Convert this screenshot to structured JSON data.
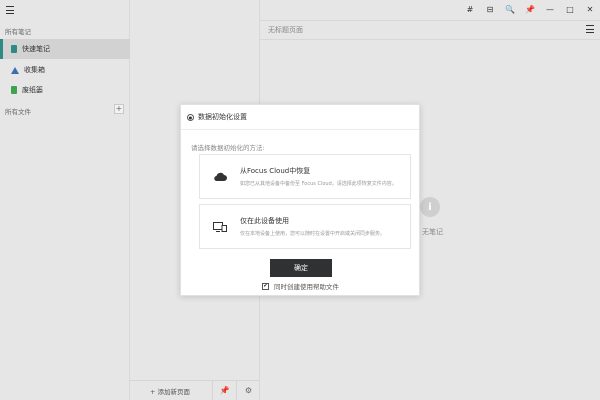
{
  "titlebar": {
    "buttons": [
      "#",
      "⊟",
      "🔍",
      "📌",
      "—",
      "□",
      "✕"
    ]
  },
  "sidebar": {
    "all_notes_title": "所有笔记",
    "items": [
      {
        "label": "快速笔记",
        "active": true,
        "icon": "note-icon"
      },
      {
        "label": "收集箱",
        "active": false,
        "icon": "inbox-icon"
      },
      {
        "label": "废纸篓",
        "active": false,
        "icon": "trash-icon"
      }
    ],
    "all_files_title": "所有文件",
    "add_label": "+"
  },
  "notelist": {
    "add_page_label": "+ 添加新页面",
    "pin_label": "📌",
    "settings_label": "⚙"
  },
  "main": {
    "page_title": "无标题页面",
    "empty_icon_glyph": "i",
    "empty_text": "无笔记"
  },
  "dialog": {
    "title": "数据初始化设置",
    "prompt": "请选择数据初始化的方法:",
    "options": [
      {
        "title": "从Focus Cloud中恢复",
        "desc": "如您已从其他设备中备份至 Focus Cloud，请选择此项恢复文件内容。",
        "icon": "cloud-icon"
      },
      {
        "title": "仅在此设备使用",
        "desc": "仅在本地设备上使用，您可以随时在设置中开启或关闭同步服务。",
        "icon": "device-icon"
      }
    ],
    "confirm_label": "确定",
    "help_label": "同时创建使用帮助文件",
    "help_checked": true
  }
}
